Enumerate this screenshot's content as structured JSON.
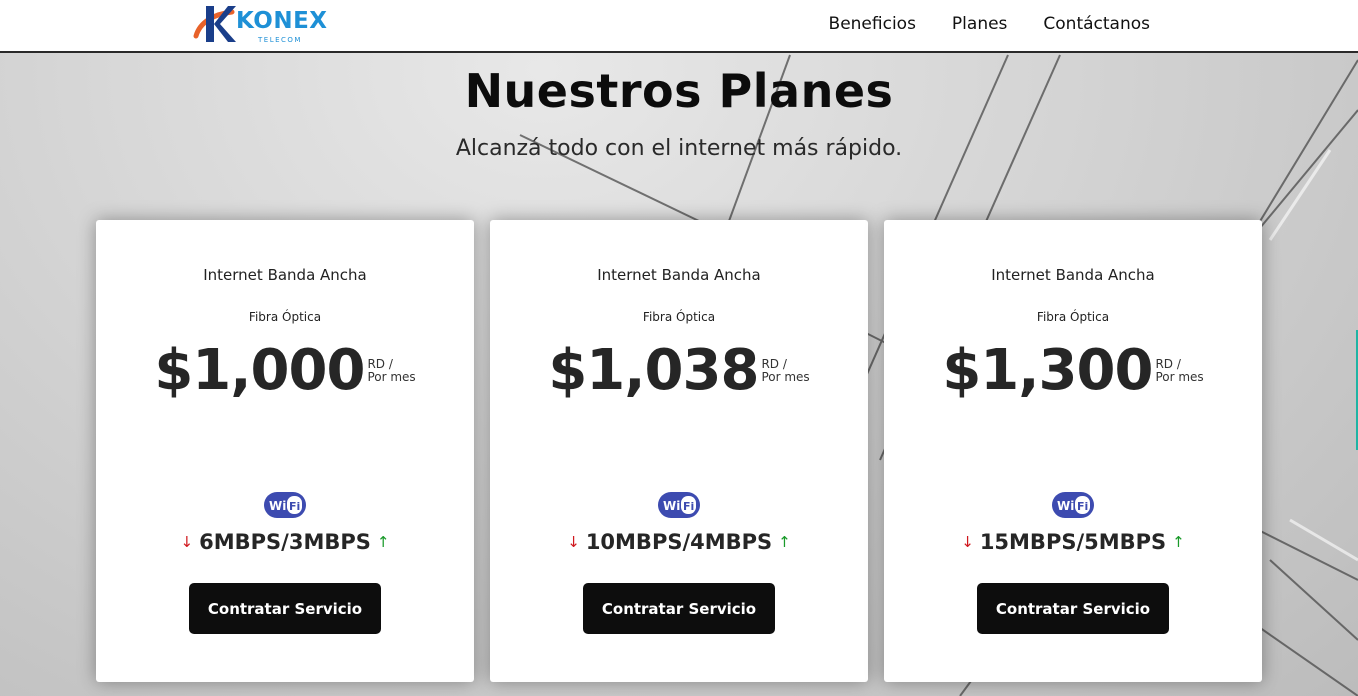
{
  "nav": {
    "logo_text": "KONEX",
    "logo_subtext": "TELECOM",
    "links": [
      "Beneficios",
      "Planes",
      "Contáctanos"
    ]
  },
  "hero": {
    "title": "Nuestros Planes",
    "subtitle": "Alcanzá todo con el internet más rápido."
  },
  "plans": [
    {
      "title": "Internet Banda Ancha",
      "type": "Fibra Óptica",
      "price": "$1,000",
      "currency": "RD /",
      "period": "Por mes",
      "speed": "6MBPS/3MBPS",
      "cta": "Contratar Servicio",
      "icon": "wifi-icon"
    },
    {
      "title": "Internet Banda Ancha",
      "type": "Fibra Óptica",
      "price": "$1,038",
      "currency": "RD /",
      "period": "Por mes",
      "speed": "10MBPS/4MBPS",
      "cta": "Contratar Servicio",
      "icon": "wifi-icon"
    },
    {
      "title": "Internet Banda Ancha",
      "type": "Fibra Óptica",
      "price": "$1,300",
      "currency": "RD /",
      "period": "Por mes",
      "speed": "15MBPS/5MBPS",
      "cta": "Contratar Servicio",
      "icon": "wifi-icon"
    }
  ],
  "colors": {
    "brand_blue": "#1e90d6",
    "brand_orange": "#e8622a",
    "download_arrow": "#d0181e",
    "upload_arrow": "#1a9a2a",
    "button_bg": "#0d0d0d",
    "wifi_blue": "#3d4bb0"
  }
}
